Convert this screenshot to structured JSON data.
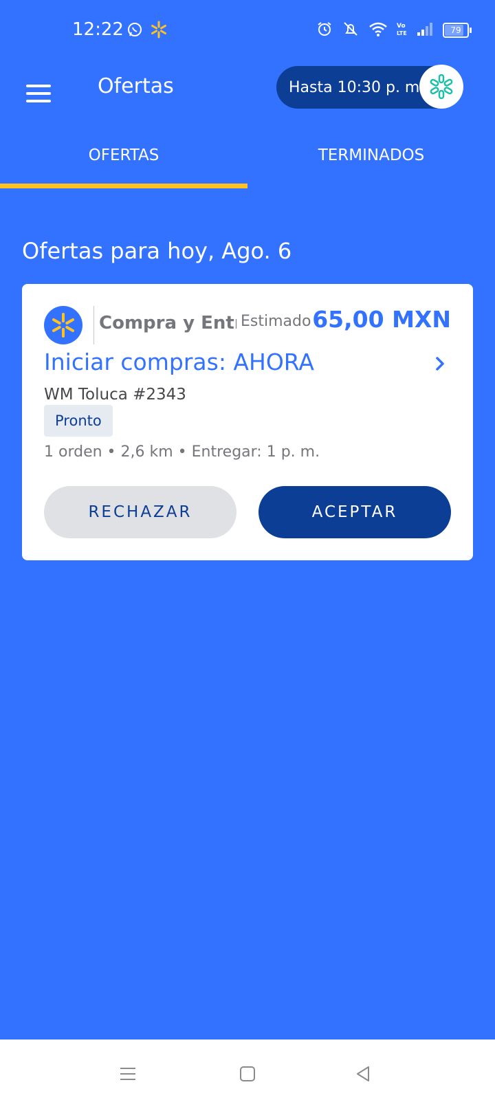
{
  "status_bar": {
    "time": "12:22",
    "battery_level": "79",
    "icons": [
      "whatsapp-icon",
      "spark-icon",
      "alarm-icon",
      "muted-bell-icon",
      "wifi-icon",
      "volte-icon",
      "signal-icon",
      "battery-icon"
    ]
  },
  "app_bar": {
    "title": "Ofertas",
    "shift_label": "Hasta 10:30 p. m."
  },
  "tabs": [
    {
      "label": "OFERTAS",
      "active": true
    },
    {
      "label": "TERMINADOS",
      "active": false
    }
  ],
  "section": {
    "heading": "Ofertas para hoy, Ago. 6"
  },
  "offer": {
    "type": "Compra y Entrega",
    "estimated_label": "Estimado",
    "amount": "65,00 MXN",
    "title": "Iniciar compras: AHORA",
    "store": "WM Toluca #2343",
    "badge": "Pronto",
    "details": "1 orden • 2,6 km • Entregar: 1 p. m.",
    "reject_label": "RECHAZAR",
    "accept_label": "ACEPTAR"
  },
  "colors": {
    "background": "#3372FF",
    "accent_yellow": "#FFC220",
    "dark_blue": "#0C3E96",
    "spark_teal": "#1DBFA8"
  }
}
